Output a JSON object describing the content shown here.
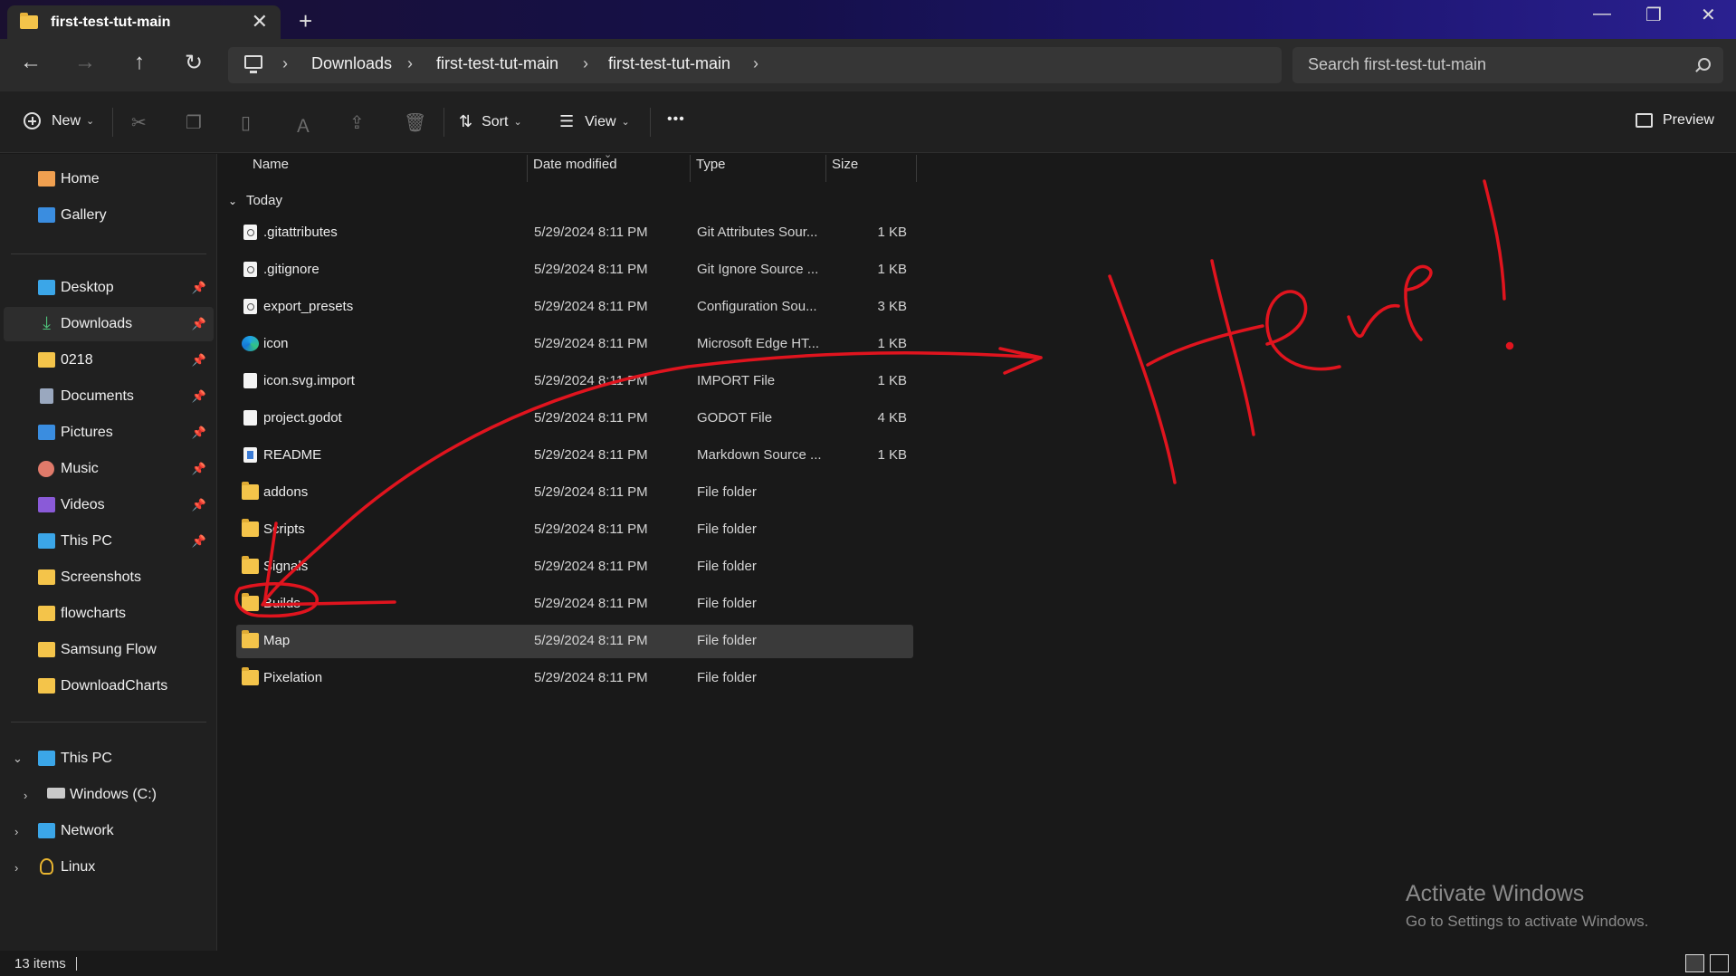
{
  "window": {
    "tab_title": "first-test-tut-main",
    "controls": {
      "minimize": "—",
      "restore": "❐",
      "close": "✕"
    }
  },
  "nav": {
    "back": "←",
    "forward": "→",
    "up": "↑",
    "refresh": "↻",
    "breadcrumbs": [
      "Downloads",
      "first-test-tut-main",
      "first-test-tut-main"
    ],
    "search_placeholder": "Search first-test-tut-main"
  },
  "commands": {
    "new_label": "New",
    "sort_label": "Sort",
    "view_label": "View",
    "more": "•••",
    "preview_label": "Preview",
    "icons": [
      "cut-icon",
      "copy-icon",
      "paste-icon",
      "rename-icon",
      "share-icon",
      "delete-icon"
    ]
  },
  "sidebar": {
    "top": [
      {
        "label": "Home",
        "icon": "home-icon"
      },
      {
        "label": "Gallery",
        "icon": "gallery-icon"
      }
    ],
    "quick_access": [
      {
        "label": "Desktop",
        "pinned": true
      },
      {
        "label": "Downloads",
        "pinned": true,
        "selected": true
      },
      {
        "label": "0218",
        "pinned": true
      },
      {
        "label": "Documents",
        "pinned": true
      },
      {
        "label": "Pictures",
        "pinned": true
      },
      {
        "label": "Music",
        "pinned": true
      },
      {
        "label": "Videos",
        "pinned": true
      },
      {
        "label": "This PC",
        "pinned": true
      },
      {
        "label": "Screenshots",
        "pinned": false
      },
      {
        "label": "flowcharts",
        "pinned": false
      },
      {
        "label": "Samsung Flow",
        "pinned": false
      },
      {
        "label": "DownloadCharts",
        "pinned": false
      }
    ],
    "tree": [
      {
        "label": "This PC",
        "expanded": true
      },
      {
        "label": "Windows (C:)",
        "expanded": false
      },
      {
        "label": "Network",
        "expanded": false
      },
      {
        "label": "Linux",
        "expanded": false
      }
    ]
  },
  "list": {
    "columns": [
      "Name",
      "Date modified",
      "Type",
      "Size"
    ],
    "group": "Today",
    "rows": [
      {
        "name": ".gitattributes",
        "date": "5/29/2024 8:11 PM",
        "type": "Git Attributes Sour...",
        "size": "1 KB",
        "icon": "config-file-icon"
      },
      {
        "name": ".gitignore",
        "date": "5/29/2024 8:11 PM",
        "type": "Git Ignore Source ...",
        "size": "1 KB",
        "icon": "config-file-icon"
      },
      {
        "name": "export_presets",
        "date": "5/29/2024 8:11 PM",
        "type": "Configuration Sou...",
        "size": "3 KB",
        "icon": "config-file-icon"
      },
      {
        "name": "icon",
        "date": "5/29/2024 8:11 PM",
        "type": "Microsoft Edge HT...",
        "size": "1 KB",
        "icon": "edge-icon"
      },
      {
        "name": "icon.svg.import",
        "date": "5/29/2024 8:11 PM",
        "type": "IMPORT File",
        "size": "1 KB",
        "icon": "file-icon"
      },
      {
        "name": "project.godot",
        "date": "5/29/2024 8:11 PM",
        "type": "GODOT File",
        "size": "4 KB",
        "icon": "file-icon"
      },
      {
        "name": "README",
        "date": "5/29/2024 8:11 PM",
        "type": "Markdown Source ...",
        "size": "1 KB",
        "icon": "markdown-file-icon"
      },
      {
        "name": "addons",
        "date": "5/29/2024 8:11 PM",
        "type": "File folder",
        "size": "",
        "icon": "folder-icon"
      },
      {
        "name": "Scripts",
        "date": "5/29/2024 8:11 PM",
        "type": "File folder",
        "size": "",
        "icon": "folder-icon"
      },
      {
        "name": "Signals",
        "date": "5/29/2024 8:11 PM",
        "type": "File folder",
        "size": "",
        "icon": "folder-icon"
      },
      {
        "name": "Builds",
        "date": "5/29/2024 8:11 PM",
        "type": "File folder",
        "size": "",
        "icon": "folder-icon"
      },
      {
        "name": "Map",
        "date": "5/29/2024 8:11 PM",
        "type": "File folder",
        "size": "",
        "icon": "folder-icon",
        "selected": true
      },
      {
        "name": "Pixelation",
        "date": "5/29/2024 8:11 PM",
        "type": "File folder",
        "size": "",
        "icon": "folder-icon"
      }
    ]
  },
  "status": {
    "count": "13 items"
  },
  "watermark": {
    "title": "Activate Windows",
    "subtitle": "Go to Settings to activate Windows."
  },
  "annotation": {
    "text": "Here!",
    "color": "#e0141e"
  }
}
